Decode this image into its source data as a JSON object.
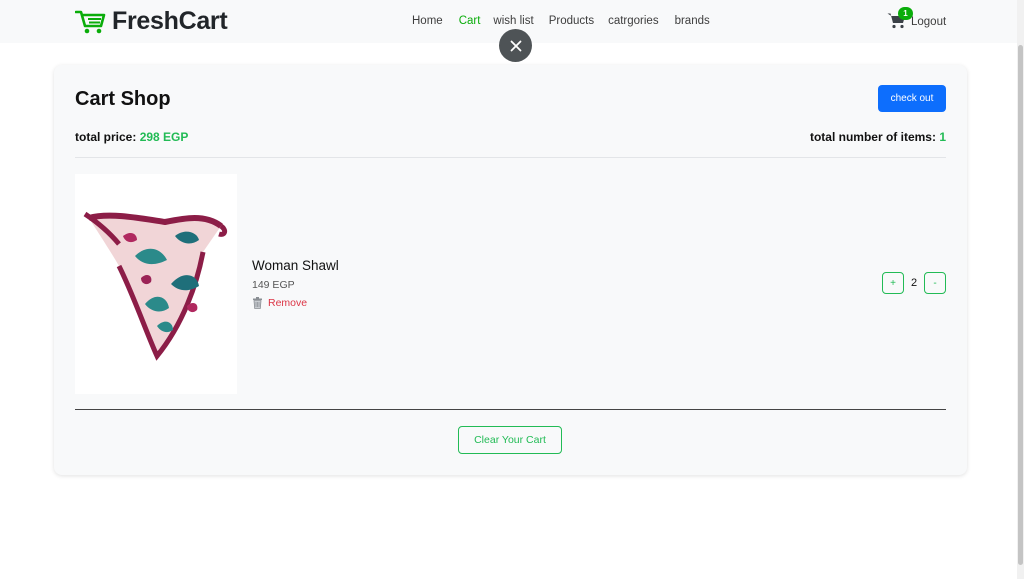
{
  "brand": {
    "name": "FreshCart",
    "accent": "#0aad0a"
  },
  "nav": {
    "home": "Home",
    "cart": "Cart",
    "wishlist": "wish list",
    "products": "Products",
    "categories": "catrgories",
    "brands": "brands"
  },
  "header": {
    "cart_count": "1",
    "logout": "Logout"
  },
  "cart": {
    "title": "Cart Shop",
    "checkout_label": "check out",
    "total_price_label": "total price:",
    "total_price_value": "298 EGP",
    "total_items_label": "total number of items:",
    "total_items_value": "1",
    "clear_label": "Clear Your Cart",
    "items": [
      {
        "name": "Woman Shawl",
        "price": "149 EGP",
        "remove_label": "Remove",
        "quantity": "2",
        "plus": "+",
        "minus": "-"
      }
    ]
  },
  "icons": {
    "cart": "cart-icon",
    "close": "close-icon",
    "trash": "trash-icon",
    "logo": "logo-cart-icon"
  }
}
